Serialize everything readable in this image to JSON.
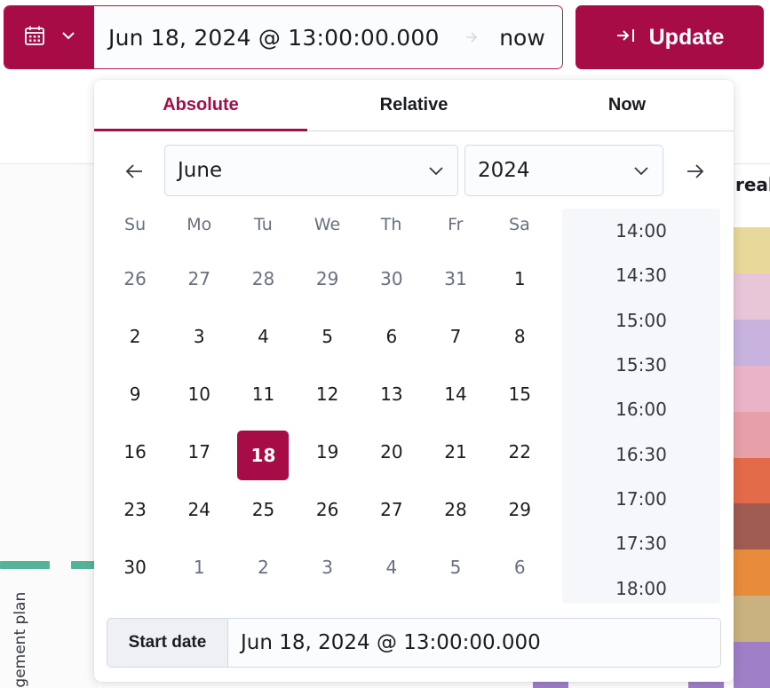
{
  "topbar": {
    "range_start": "Jun 18, 2024 @ 13:00:00.000",
    "range_end": "now",
    "update_label": "Update"
  },
  "background": {
    "panel_title_fragment": "reak",
    "axis_label_fragment": "agement plan",
    "series_colors": [
      "#e8d99a",
      "#e9c5d8",
      "#c7b3de",
      "#ebb3c7",
      "#e8a0a8",
      "#e36b4a",
      "#a05b53",
      "#e88c3b",
      "#c9b27f",
      "#9f7fc7"
    ]
  },
  "popover": {
    "tabs": [
      {
        "label": "Absolute",
        "active": true
      },
      {
        "label": "Relative",
        "active": false
      },
      {
        "label": "Now",
        "active": false
      }
    ],
    "month": "June",
    "year": "2024",
    "weekdays": [
      "Su",
      "Mo",
      "Tu",
      "We",
      "Th",
      "Fr",
      "Sa"
    ],
    "days": [
      {
        "d": "26",
        "out": true
      },
      {
        "d": "27",
        "out": true
      },
      {
        "d": "28",
        "out": true
      },
      {
        "d": "29",
        "out": true
      },
      {
        "d": "30",
        "out": true
      },
      {
        "d": "31",
        "out": true
      },
      {
        "d": "1",
        "out": false
      },
      {
        "d": "2",
        "out": false
      },
      {
        "d": "3",
        "out": false
      },
      {
        "d": "4",
        "out": false
      },
      {
        "d": "5",
        "out": false
      },
      {
        "d": "6",
        "out": false
      },
      {
        "d": "7",
        "out": false
      },
      {
        "d": "8",
        "out": false
      },
      {
        "d": "9",
        "out": false
      },
      {
        "d": "10",
        "out": false
      },
      {
        "d": "11",
        "out": false
      },
      {
        "d": "12",
        "out": false
      },
      {
        "d": "13",
        "out": false
      },
      {
        "d": "14",
        "out": false
      },
      {
        "d": "15",
        "out": false
      },
      {
        "d": "16",
        "out": false
      },
      {
        "d": "17",
        "out": false
      },
      {
        "d": "18",
        "out": false,
        "selected": true
      },
      {
        "d": "19",
        "out": false
      },
      {
        "d": "20",
        "out": false
      },
      {
        "d": "21",
        "out": false
      },
      {
        "d": "22",
        "out": false
      },
      {
        "d": "23",
        "out": false
      },
      {
        "d": "24",
        "out": false
      },
      {
        "d": "25",
        "out": false
      },
      {
        "d": "26",
        "out": false
      },
      {
        "d": "27",
        "out": false
      },
      {
        "d": "28",
        "out": false
      },
      {
        "d": "29",
        "out": false
      },
      {
        "d": "30",
        "out": false
      },
      {
        "d": "1",
        "out": true
      },
      {
        "d": "2",
        "out": true
      },
      {
        "d": "3",
        "out": true
      },
      {
        "d": "4",
        "out": true
      },
      {
        "d": "5",
        "out": true
      },
      {
        "d": "6",
        "out": true
      }
    ],
    "times": [
      "14:00",
      "14:30",
      "15:00",
      "15:30",
      "16:00",
      "16:30",
      "17:00",
      "17:30",
      "18:00"
    ],
    "footer_label": "Start date",
    "footer_value": "Jun 18, 2024 @ 13:00:00.000"
  },
  "colors": {
    "accent": "#a80c47",
    "accent_border": "#b0144e",
    "muted_text": "#69707d"
  }
}
